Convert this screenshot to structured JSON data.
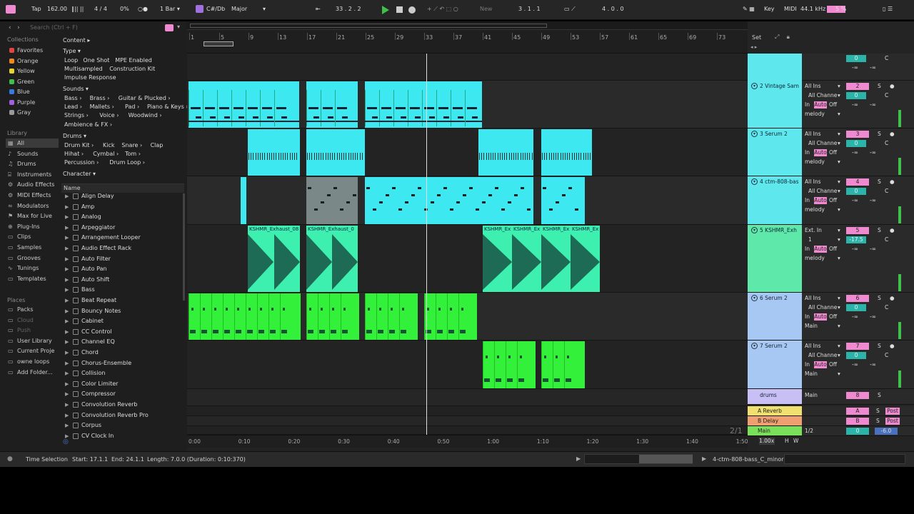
{
  "transport": {
    "tap": "Tap",
    "tempo": "162.00",
    "meter": "4 / 4",
    "pct": "0%",
    "quant": "1 Bar",
    "key": "C#/Db",
    "scale": "Major",
    "position": "33 .  2 .  2",
    "new": "New",
    "loop_start": "3 .  1 .  1",
    "loop_len": "4 .  0 .  0",
    "key_btn": "Key",
    "midi_btn": "MIDI",
    "samplerate": "44.1 kHz",
    "cpu": "5 %"
  },
  "browser": {
    "search": "Search (Ctrl + F)",
    "collections_title": "Collections",
    "collections": [
      {
        "label": "Favorites",
        "color": "#e04545"
      },
      {
        "label": "Orange",
        "color": "#f08a20"
      },
      {
        "label": "Yellow",
        "color": "#e6d530"
      },
      {
        "label": "Green",
        "color": "#3ec04a"
      },
      {
        "label": "Blue",
        "color": "#3a7ae0"
      },
      {
        "label": "Purple",
        "color": "#a060e0"
      },
      {
        "label": "Gray",
        "color": "#999999"
      }
    ],
    "library_title": "Library",
    "library": [
      "All",
      "Sounds",
      "Drums",
      "Instruments",
      "Audio Effects",
      "MIDI Effects",
      "Modulators",
      "Max for Live",
      "Plug-Ins",
      "Clips",
      "Samples",
      "Grooves",
      "Tunings",
      "Templates"
    ],
    "places_title": "Places",
    "places": [
      "Packs",
      "Cloud",
      "Push",
      "User Library",
      "Current Proje",
      "owne loops",
      "Add Folder..."
    ],
    "content": "Content ▸",
    "type": "Type ▾",
    "type_tags": [
      "Loop",
      "One Shot",
      "MPE Enabled",
      "Multisampled",
      "Construction Kit",
      "Impulse Response"
    ],
    "sounds": "Sounds ▾",
    "sounds_tags": [
      "Bass ›",
      "Brass ›",
      "Guitar & Plucked ›",
      "Lead ›",
      "Mallets ›",
      "Pad ›",
      "Piano & Keys ›",
      "Strings ›",
      "Voice ›",
      "Woodwind ›",
      "Ambience & FX ›"
    ],
    "drums": "Drums ▾",
    "drums_tags": [
      "Drum Kit ›",
      "Kick",
      "Snare ›",
      "Clap",
      "Hihat ›",
      "Cymbal ›",
      "Tom ›",
      "Percussion ›",
      "Drum Loop ›"
    ],
    "character": "Character ▾",
    "name_header": "Name",
    "items": [
      "Align Delay",
      "Amp",
      "Analog",
      "Arpeggiator",
      "Arrangement Looper",
      "Audio Effect Rack",
      "Auto Filter",
      "Auto Pan",
      "Auto Shift",
      "Bass",
      "Beat Repeat",
      "Bouncy Notes",
      "Cabinet",
      "CC Control",
      "Channel EQ",
      "Chord",
      "Chorus-Ensemble",
      "Collision",
      "Color Limiter",
      "Compressor",
      "Convolution Reverb",
      "Convolution Reverb Pro",
      "Corpus",
      "CV Clock In"
    ]
  },
  "ruler": {
    "bars": [
      "1",
      "5",
      "9",
      "13",
      "17",
      "21",
      "25",
      "29",
      "33",
      "37",
      "41",
      "45",
      "49",
      "53",
      "57",
      "61",
      "65",
      "69",
      "73"
    ],
    "times": [
      "0:00",
      "0:10",
      "0:20",
      "0:30",
      "0:40",
      "0:50",
      "1:00",
      "1:10",
      "1:20",
      "1:30",
      "1:40",
      "1:50"
    ]
  },
  "clips": {
    "audio_name": "KSHMR_Exhaust_08",
    "audio_a": "KSHMR_Exhaust_08",
    "audio_b": "KSHMR_Exhaust_0",
    "audio_short": "KSHMR_Ex"
  },
  "mixer": {
    "set": "Set",
    "tracks": [
      {
        "name": "2 Vintage Sam",
        "num": "2",
        "input": "All Ins",
        "chan": "All Channe",
        "auto": "Auto",
        "off": "Off",
        "out": "melody",
        "color": "#5ee8ee"
      },
      {
        "name": "3 Serum 2",
        "num": "3",
        "input": "All Ins",
        "chan": "All Channe",
        "auto": "Auto",
        "off": "Off",
        "out": "melody",
        "color": "#5ee8ee"
      },
      {
        "name": "4 ctm-808-bas",
        "num": "4",
        "input": "All Ins",
        "chan": "All Channe",
        "auto": "Auto",
        "off": "Off",
        "out": "melody",
        "color": "#5ee8ee"
      },
      {
        "name": "5 KSHMR_Exh",
        "num": "5",
        "input": "Ext. In",
        "chan": "1",
        "auto": "Auto",
        "off": "Off",
        "out": "melody",
        "color": "#5ee8aa",
        "vol": "-17.5"
      },
      {
        "name": "6 Serum 2",
        "num": "6",
        "input": "All Ins",
        "chan": "All Channe",
        "auto": "Auto",
        "off": "Off",
        "out": "Main",
        "color": "#a8c8f4"
      },
      {
        "name": "7 Serum 2",
        "num": "7",
        "input": "All Ins",
        "chan": "All Channe",
        "auto": "Auto",
        "off": "Off",
        "out": "Main",
        "color": "#a8c8f4"
      }
    ],
    "drums": {
      "name": "drums",
      "out": "Main",
      "num": "8"
    },
    "returns": [
      {
        "name": "A Reverb",
        "letter": "A",
        "post": "Post"
      },
      {
        "name": "B Delay",
        "letter": "B",
        "post": "Post"
      }
    ],
    "main": {
      "name": "Main",
      "route": "1/2",
      "vol": "0",
      "db": "-6.0"
    },
    "zero": "0",
    "c": "C",
    "inf": "-∞",
    "s": "S",
    "in": "In",
    "page": "2/1",
    "zoom": "1.00x",
    "h": "H",
    "w": "W"
  },
  "status": {
    "mode": "Time Selection",
    "start": "Start: 17.1.1",
    "end": "End: 24.1.1",
    "length": "Length: 7.0.0 (Duration: 0:10:370)",
    "clip": "4-ctm-808-bass_C_minor"
  }
}
